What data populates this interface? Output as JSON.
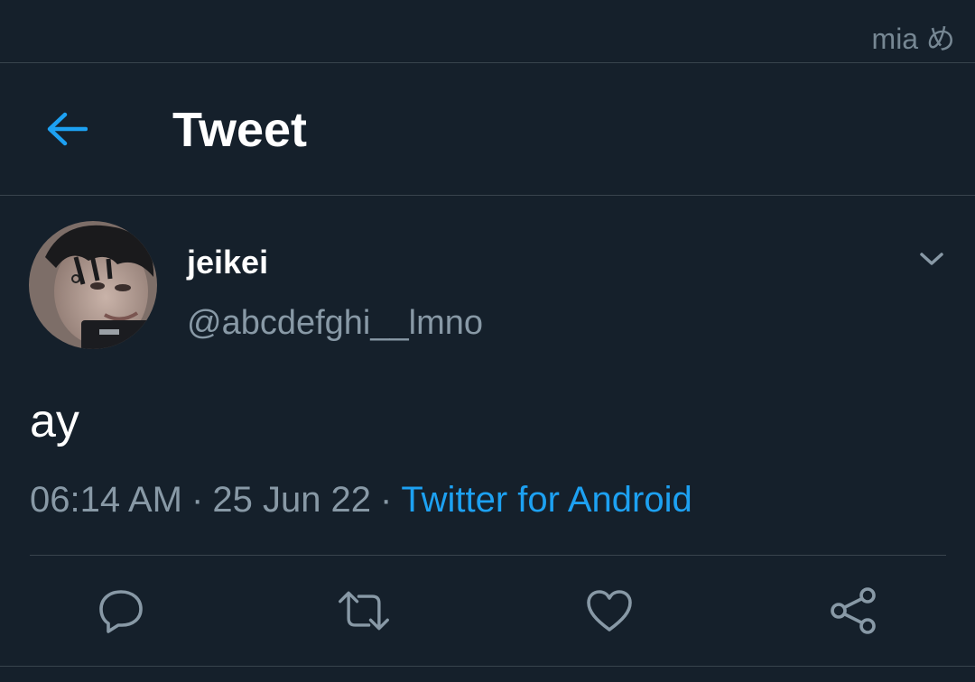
{
  "watermark": "mia め",
  "header": {
    "title": "Tweet",
    "back_icon": "arrow-left-icon"
  },
  "tweet": {
    "author": {
      "display_name": "jeikei",
      "handle": "@abcdefghi__lmno",
      "avatar": "profile-photo"
    },
    "text": "ay",
    "time": "06:14 AM",
    "date": "25 Jun 22",
    "separator": "·",
    "source": "Twitter for Android"
  },
  "actions": [
    {
      "name": "reply",
      "icon": "reply-icon"
    },
    {
      "name": "retweet",
      "icon": "retweet-icon"
    },
    {
      "name": "like",
      "icon": "heart-icon"
    },
    {
      "name": "share",
      "icon": "share-icon"
    }
  ],
  "colors": {
    "background": "#15202b",
    "accent": "#1da1f2",
    "secondary_text": "#8899a6",
    "divider": "#38444d"
  }
}
